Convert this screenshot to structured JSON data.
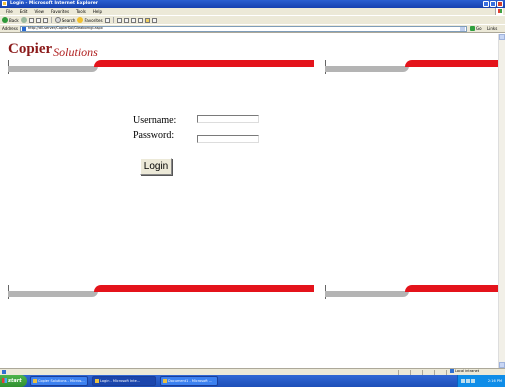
{
  "window": {
    "title": "Login - Microsoft Internet Explorer"
  },
  "menu": {
    "items": [
      "File",
      "Edit",
      "View",
      "Favorites",
      "Tools",
      "Help"
    ]
  },
  "toolbar": {
    "back_label": "Back",
    "search_label": "Search",
    "favorites_label": "Favorites"
  },
  "address": {
    "label": "Address",
    "url": "http://dll-server/CopierSol/Gleaborngl.aspx",
    "go_label": "Go",
    "links_label": "Links"
  },
  "brand": {
    "name_part1": "Copier",
    "name_part2": "Solutions",
    "color": "#8b1a1a",
    "accent_red": "#e4131b",
    "accent_grey": "#b4b4b4"
  },
  "login": {
    "username_label": "Username:",
    "password_label": "Password:",
    "username_value": "",
    "password_value": "",
    "button_label": "Login"
  },
  "status": {
    "zone_label": "Local intranet"
  },
  "taskbar": {
    "start_label": "start",
    "tasks": [
      {
        "label": "Copier Solutions - Micros..."
      },
      {
        "label": "Login - Microsoft Inte..."
      },
      {
        "label": "Document1 - Microsoft ..."
      }
    ],
    "clock": "2:16 PM"
  }
}
